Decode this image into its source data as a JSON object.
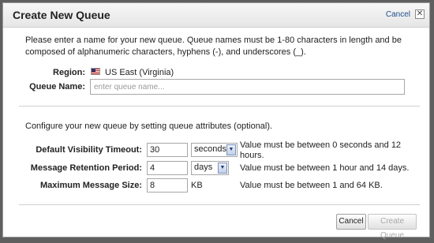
{
  "dialog": {
    "title": "Create New Queue",
    "cancel_link": "Cancel",
    "close_glyph": "✕"
  },
  "intro_text": "Please enter a name for your new queue. Queue names must be 1-80 characters in length and be composed of alphanumeric characters, hyphens (-), and underscores (_).",
  "region": {
    "label": "Region:",
    "value": "US East (Virginia)",
    "flag_icon": "us-flag-icon"
  },
  "queue_name": {
    "label": "Queue Name:",
    "placeholder": "enter queue name...",
    "value": ""
  },
  "attributes_intro": "Configure your new queue by setting queue attributes (optional).",
  "attributes": {
    "visibility_timeout": {
      "label": "Default Visibility Timeout:",
      "value": "30",
      "unit": "seconds",
      "help": "Value must be between 0 seconds and 12 hours."
    },
    "retention_period": {
      "label": "Message Retention Period:",
      "value": "4",
      "unit": "days",
      "help": "Value must be between 1 hour and 14 days."
    },
    "max_message_size": {
      "label": "Maximum Message Size:",
      "value": "8",
      "unit": "KB",
      "help": "Value must be between 1 and 64 KB."
    }
  },
  "buttons": {
    "cancel": "Cancel",
    "create": "Create Queue"
  },
  "colors": {
    "overlay": "#5f5f5f",
    "link": "#1f4f8f",
    "disabled_text": "#a9a9a9"
  }
}
